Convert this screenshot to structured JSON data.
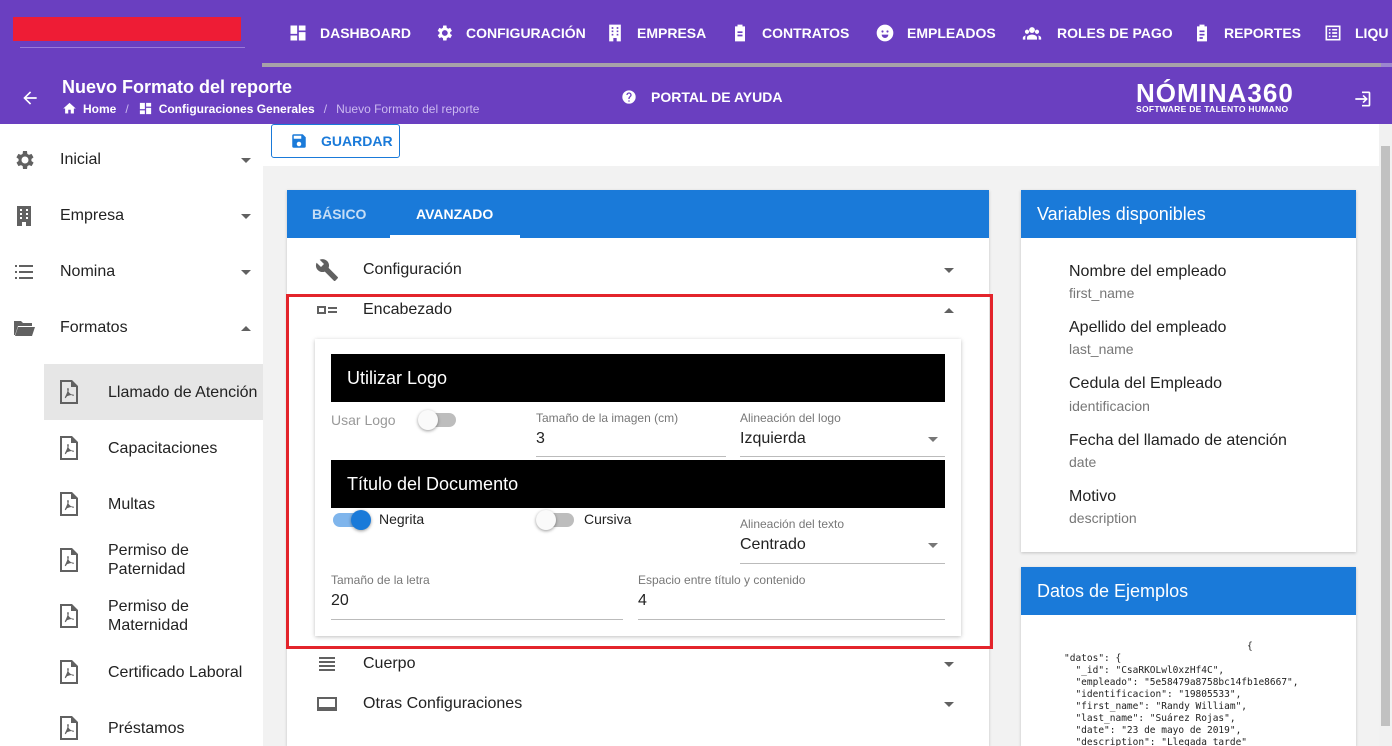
{
  "nav": {
    "items": [
      {
        "label": "DASHBOARD",
        "icon": "dashboard-icon"
      },
      {
        "label": "CONFIGURACIÓN",
        "icon": "gear-icon"
      },
      {
        "label": "EMPRESA",
        "icon": "building-icon"
      },
      {
        "label": "CONTRATOS",
        "icon": "clipboard-icon"
      },
      {
        "label": "EMPLEADOS",
        "icon": "face-icon"
      },
      {
        "label": "ROLES DE PAGO",
        "icon": "people-icon"
      },
      {
        "label": "REPORTES",
        "icon": "clipboard-text-icon"
      },
      {
        "label": "LIQU",
        "icon": "list-box-icon"
      }
    ],
    "accent": "#6a3fc0"
  },
  "header": {
    "title": "Nuevo Formato del reporte",
    "breadcrumb": [
      "Home",
      "Configuraciones Generales",
      "Nuevo Formato del reporte"
    ],
    "help": "PORTAL DE AYUDA",
    "brand_name": "NÓMINA360",
    "brand_sub": "SOFTWARE DE TALENTO HUMANO"
  },
  "sidebar": {
    "items": [
      {
        "label": "Inicial",
        "icon": "gear-icon",
        "expanded": false
      },
      {
        "label": "Empresa",
        "icon": "building-icon",
        "expanded": false
      },
      {
        "label": "Nomina",
        "icon": "list-icon",
        "expanded": false
      },
      {
        "label": "Formatos",
        "icon": "folder-open-icon",
        "expanded": true
      }
    ],
    "subitems": [
      "Llamado de Atención",
      "Capacitaciones",
      "Multas",
      "Permiso de Paternidad",
      "Permiso de Maternidad",
      "Certificado Laboral",
      "Préstamos"
    ],
    "active": "Llamado de Atención"
  },
  "toolbar": {
    "save_label": "GUARDAR"
  },
  "tabs": [
    {
      "label": "BÁSICO",
      "active": false
    },
    {
      "label": "AVANZADO",
      "active": true
    }
  ],
  "sections": {
    "configuracion": "Configuración",
    "encabezado": "Encabezado",
    "cuerpo": "Cuerpo",
    "otras": "Otras Configuraciones"
  },
  "logo": {
    "title": "Utilizar Logo",
    "use_label": "Usar Logo",
    "use_value": false,
    "size_label": "Tamaño de la imagen (cm)",
    "size_value": "3",
    "align_label": "Alineación del logo",
    "align_value": "Izquierda"
  },
  "doc_title": {
    "title": "Título del Documento",
    "bold_label": "Negrita",
    "bold_value": true,
    "italic_label": "Cursiva",
    "italic_value": false,
    "align_label": "Alineación del texto",
    "align_value": "Centrado",
    "font_size_label": "Tamaño de la letra",
    "font_size_value": "20",
    "spacing_label": "Espacio entre título y contenido",
    "spacing_value": "4"
  },
  "variables": {
    "title": "Variables disponibles",
    "items": [
      {
        "name": "Nombre del empleado",
        "key": "first_name"
      },
      {
        "name": "Apellido del empleado",
        "key": "last_name"
      },
      {
        "name": "Cedula del Empleado",
        "key": "identificacion"
      },
      {
        "name": "Fecha del llamado de atención",
        "key": "date"
      },
      {
        "name": "Motivo",
        "key": "description"
      }
    ]
  },
  "examples": {
    "title": "Datos de Ejemplos",
    "lines": [
      "                                {",
      "\"datos\": {",
      "  \"_id\": \"CsaRKOLwl0xzHf4C\",",
      "  \"empleado\": \"5e58479a8758bc14fb1e8667\",",
      "  \"identificacion\": \"19805533\",",
      "  \"first_name\": \"Randy William\",",
      "  \"last_name\": \"Suárez Rojas\",",
      "  \"date\": \"23 de mayo de 2019\",",
      "  \"description\": \"Llegada tarde\""
    ]
  }
}
